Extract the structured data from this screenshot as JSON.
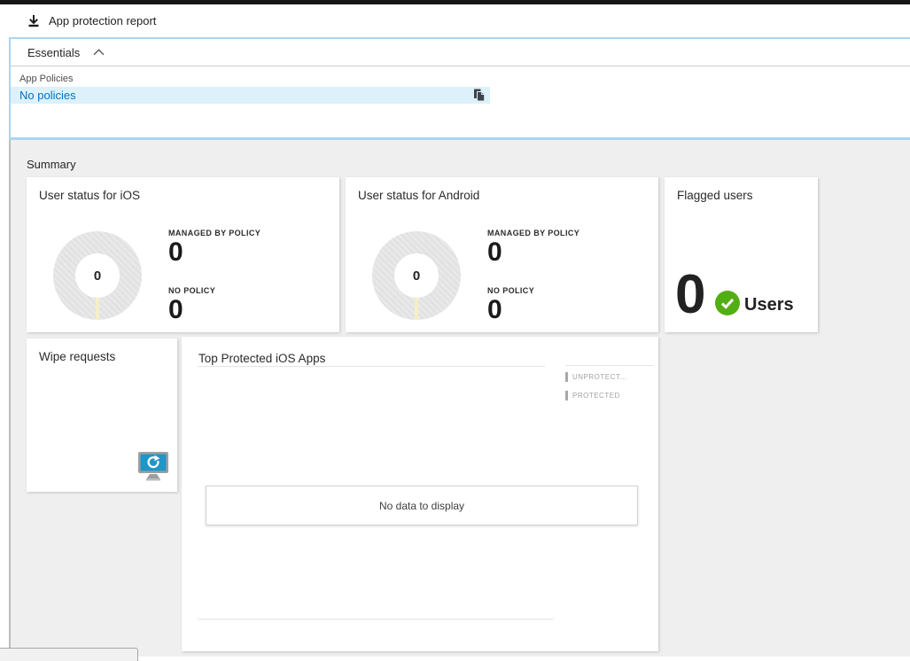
{
  "toolbar": {
    "title": "App protection report"
  },
  "essentials": {
    "title": "Essentials",
    "app_policies_label": "App Policies",
    "app_policies_value": "No policies"
  },
  "summary": {
    "title": "Summary",
    "ios_card": {
      "title": "User status for iOS",
      "donut_center": "0",
      "metric1_label": "MANAGED BY POLICY",
      "metric1_value": "0",
      "metric2_label": "NO POLICY",
      "metric2_value": "0"
    },
    "android_card": {
      "title": "User status for Android",
      "donut_center": "0",
      "metric1_label": "MANAGED BY POLICY",
      "metric1_value": "0",
      "metric2_label": "NO POLICY",
      "metric2_value": "0"
    },
    "flagged_card": {
      "title": "Flagged users",
      "count": "0",
      "unit": "Users"
    },
    "wipe_card": {
      "title": "Wipe requests"
    },
    "top_apps_card": {
      "title": "Top Protected iOS Apps",
      "legend1": "UNPROTECT...",
      "legend2": "PROTECTED",
      "empty_message": "No data to display"
    }
  },
  "colors": {
    "accent_blue": "#0072c6",
    "panel_border_blue": "#a9d6ef",
    "highlight_row_blue": "#ddf1fb",
    "background_gray": "#efefef",
    "donut_gray": "#e2e2e2",
    "donut_tick_cream": "#f5efc9",
    "flag_green": "#53ae14",
    "legend_gray": "#a3a3a3",
    "wipe_icon_blue": "#2095c8"
  },
  "chart_data": [
    {
      "type": "pie",
      "title": "User status for iOS",
      "categories": [
        "MANAGED BY POLICY",
        "NO POLICY"
      ],
      "values": [
        0,
        0
      ],
      "center_total": 0,
      "note": "empty donut, gray placeholder ring with small tick at bottom"
    },
    {
      "type": "pie",
      "title": "User status for Android",
      "categories": [
        "MANAGED BY POLICY",
        "NO POLICY"
      ],
      "values": [
        0,
        0
      ],
      "center_total": 0,
      "note": "empty donut, gray placeholder ring with small tick at bottom"
    },
    {
      "type": "bar",
      "title": "Top Protected iOS Apps",
      "categories": [],
      "series": [
        {
          "name": "UNPROTECT...",
          "values": []
        },
        {
          "name": "PROTECTED",
          "values": []
        }
      ],
      "legend_position": "top-right",
      "note": "No data to display"
    }
  ]
}
